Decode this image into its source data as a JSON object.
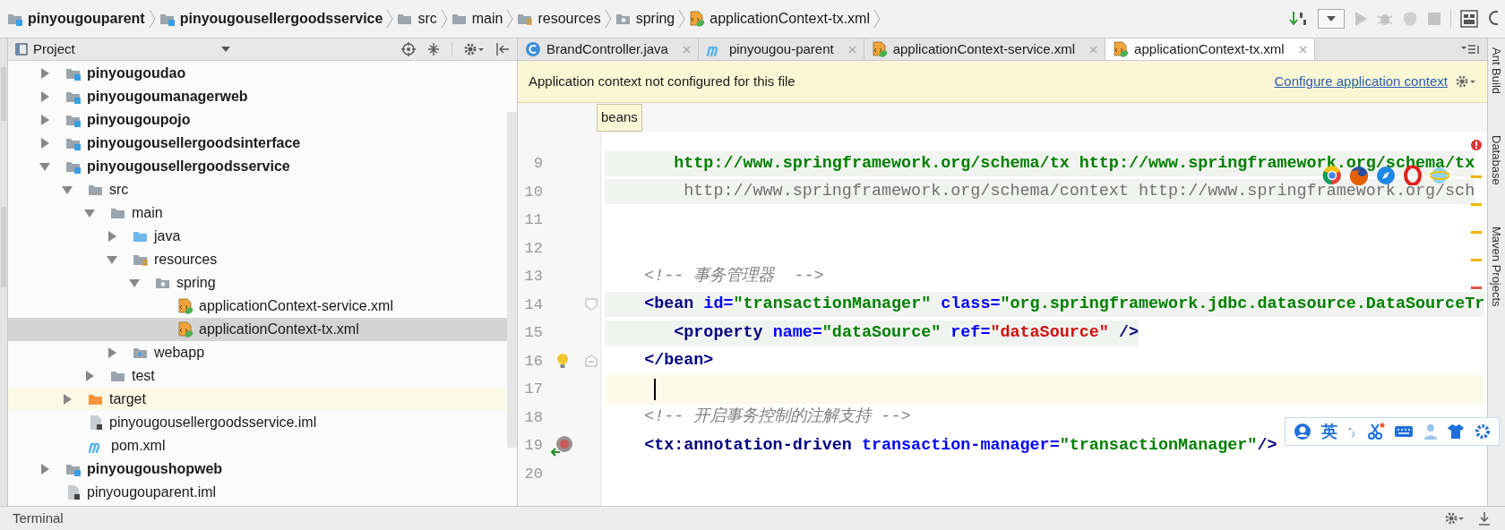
{
  "breadcrumbs": [
    {
      "label": "pinyougouparent",
      "kind": "module"
    },
    {
      "label": "pinyougousellergoodsservice",
      "kind": "module"
    },
    {
      "label": "src",
      "kind": "folder"
    },
    {
      "label": "main",
      "kind": "folder"
    },
    {
      "label": "resources",
      "kind": "resource-folder"
    },
    {
      "label": "spring",
      "kind": "package"
    },
    {
      "label": "applicationContext-tx.xml",
      "kind": "spring-xml"
    }
  ],
  "project_panel": {
    "title": "Project",
    "tree": [
      {
        "label": "pinyougoudao",
        "kind": "module",
        "expanded": false,
        "selected": false
      },
      {
        "label": "pinyougoumanagerweb",
        "kind": "module",
        "expanded": false,
        "selected": false
      },
      {
        "label": "pinyougoupojo",
        "kind": "module",
        "expanded": false,
        "selected": false
      },
      {
        "label": "pinyougousellergoodsinterface",
        "kind": "module",
        "expanded": false,
        "selected": false
      },
      {
        "label": "pinyougousellergoodsservice",
        "kind": "module",
        "expanded": true,
        "selected": false,
        "children": [
          {
            "label": "src",
            "kind": "folder",
            "expanded": true,
            "selected": false,
            "children": [
              {
                "label": "main",
                "kind": "folder",
                "expanded": true,
                "selected": false,
                "children": [
                  {
                    "label": "java",
                    "kind": "source-folder",
                    "expanded": false,
                    "selected": false
                  },
                  {
                    "label": "resources",
                    "kind": "resource-folder",
                    "expanded": true,
                    "selected": false,
                    "children": [
                      {
                        "label": "spring",
                        "kind": "package",
                        "expanded": true,
                        "selected": false,
                        "children": [
                          {
                            "label": "applicationContext-service.xml",
                            "kind": "spring-xml",
                            "selected": false
                          },
                          {
                            "label": "applicationContext-tx.xml",
                            "kind": "spring-xml",
                            "selected": true
                          }
                        ]
                      }
                    ]
                  },
                  {
                    "label": "webapp",
                    "kind": "web-folder",
                    "expanded": false,
                    "selected": false
                  }
                ]
              },
              {
                "label": "test",
                "kind": "folder",
                "expanded": false,
                "selected": false
              }
            ]
          },
          {
            "label": "target",
            "kind": "excluded-folder",
            "expanded": false,
            "selected": false
          },
          {
            "label": "pinyougousellergoodsservice.iml",
            "kind": "iml",
            "selected": false
          },
          {
            "label": "pom.xml",
            "kind": "maven",
            "selected": false
          }
        ]
      },
      {
        "label": "pinyougoushopweb",
        "kind": "module",
        "expanded": false,
        "selected": false
      },
      {
        "label": "pinyougouparent.iml",
        "kind": "iml",
        "selected": false
      }
    ]
  },
  "editor_tabs": [
    {
      "label": "BrandController.java",
      "kind": "class",
      "selected": false
    },
    {
      "label": "pinyougou-parent",
      "kind": "maven",
      "selected": false
    },
    {
      "label": "applicationContext-service.xml",
      "kind": "spring-xml",
      "selected": false
    },
    {
      "label": "applicationContext-tx.xml",
      "kind": "spring-xml",
      "selected": true
    }
  ],
  "notification": {
    "message": "Application context not configured for this file",
    "link": "Configure application context"
  },
  "editor": {
    "breadcrumb": "beans",
    "lines": [
      {
        "number": "9",
        "shaded": true,
        "current": false,
        "tokens": [
          {
            "kind": "url",
            "text": "       http://www.springframework.org/schema/tx http://www.springframework.org/schema/tx"
          }
        ]
      },
      {
        "number": "10",
        "shaded": true,
        "current": false,
        "tokens": [
          {
            "kind": "plain",
            "text": "        http://www.springframework.org/schema/context http://www.springframework.org/sch"
          }
        ]
      },
      {
        "number": "11"
      },
      {
        "number": "12"
      },
      {
        "number": "13",
        "shaded": false,
        "current": false,
        "tokens": [
          {
            "kind": "comment",
            "text": "    <!-- 事务管理器  -->"
          }
        ]
      },
      {
        "number": "14",
        "shaded": true,
        "current": false,
        "kind": "fold-start",
        "tokens": [
          {
            "kind": "tag",
            "text": "    <bean"
          },
          {
            "kind": "attr",
            "text": " id="
          },
          {
            "kind": "value",
            "text": "\"transactionManager\""
          },
          {
            "kind": "attr",
            "text": " class="
          },
          {
            "kind": "value",
            "text": "\"org.springframework.jdbc.datasource.DataSourceTr"
          }
        ]
      },
      {
        "number": "15",
        "shaded": true,
        "current": false,
        "tokens": [
          {
            "kind": "tag",
            "text": "       <property"
          },
          {
            "kind": "attr",
            "text": " name="
          },
          {
            "kind": "value",
            "text": "\"dataSource\""
          },
          {
            "kind": "attr",
            "text": " ref="
          },
          {
            "kind": "error-value",
            "text": "\"dataSource\""
          },
          {
            "kind": "tag",
            "text": " />"
          }
        ]
      },
      {
        "number": "16",
        "shaded": false,
        "current": false,
        "kind": "fold-end-hint",
        "tokens": [
          {
            "kind": "tag",
            "text": "    </bean>"
          }
        ]
      },
      {
        "number": "17",
        "current": true
      },
      {
        "number": "18",
        "shaded": false,
        "current": false,
        "tokens": [
          {
            "kind": "comment",
            "text": "    <!-- 开启事务控制的注解支持 -->"
          }
        ]
      },
      {
        "number": "19",
        "shaded": false,
        "current": false,
        "kind": "navigation",
        "tokens": [
          {
            "kind": "tag",
            "text": "    <tx:annotation-driven"
          },
          {
            "kind": "attr",
            "text": " transaction-manager="
          },
          {
            "kind": "value",
            "text": "\"transactionManager\""
          },
          {
            "kind": "tag",
            "text": "/>"
          }
        ]
      },
      {
        "number": "20"
      }
    ]
  },
  "side_tools": [
    "Ant Build",
    "Database",
    "Maven Projects"
  ],
  "input_method_bar": {
    "mode": "英"
  },
  "bottom_bar": {
    "title": "Terminal"
  }
}
